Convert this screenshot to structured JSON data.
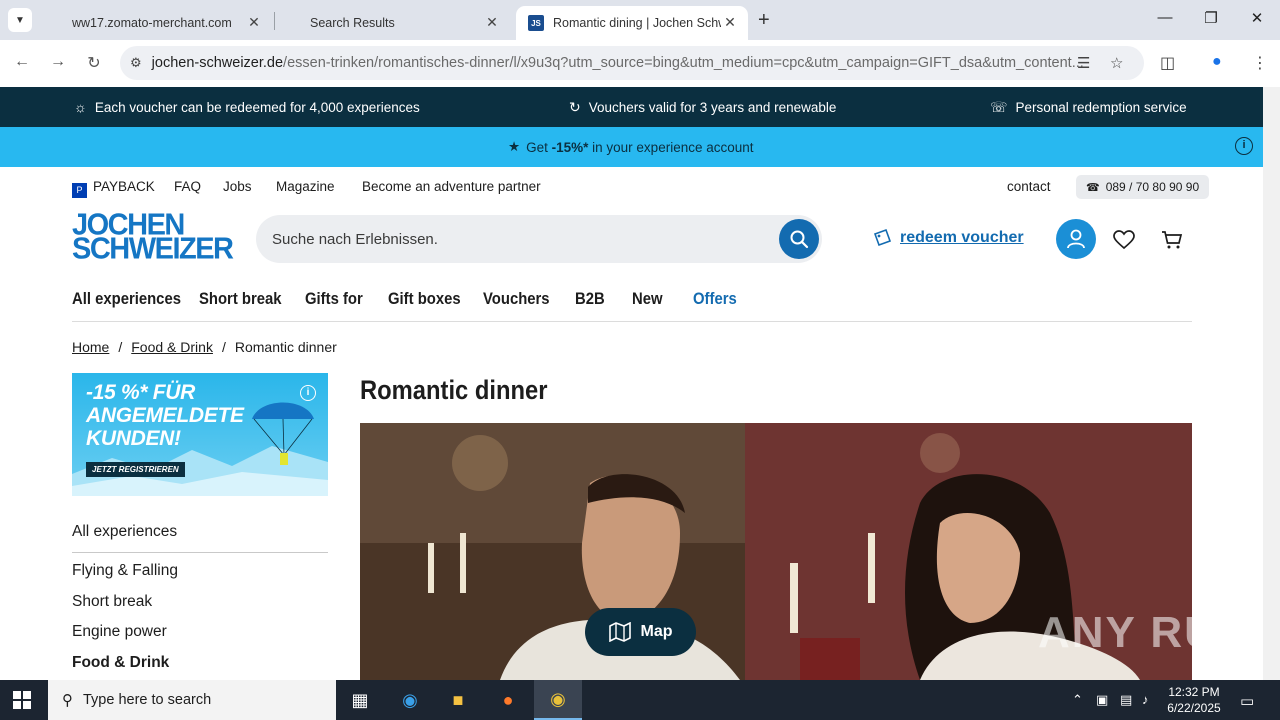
{
  "browser": {
    "tabs": [
      {
        "title": "ww17.zomato-merchant.com"
      },
      {
        "title": "Search Results"
      },
      {
        "title": "Romantic dining | Jochen Schweizer",
        "favicon": "JS"
      }
    ],
    "url_domain": "jochen-schweizer.de",
    "url_path": "/essen-trinken/romantisches-dinner/l/x9u3q?utm_source=bing&utm_medium=cpc&utm_campaign=GIFT_dsa&utm_content..."
  },
  "topbar": {
    "usp1": "Each voucher can be redeemed for 4,000 experiences",
    "usp2": "Vouchers valid for 3 years and renewable",
    "usp3": "Personal redemption service"
  },
  "promo": {
    "prefix": "Get ",
    "discount": "-15%*",
    "suffix": " in your experience account"
  },
  "meta_links": {
    "payback": "PAYBACK",
    "faq": "FAQ",
    "jobs": "Jobs",
    "magazine": "Magazine",
    "partner": "Become an adventure partner",
    "contact": "contact",
    "phone": "089 / 70 80 90 90"
  },
  "logo": {
    "line1": "JOCHEN",
    "line2": "SCHWEIZER"
  },
  "search": {
    "placeholder": "Suche nach Erlebnissen."
  },
  "redeem": {
    "label": "redeem voucher"
  },
  "nav": [
    "All experiences",
    "Short break",
    "Gifts for",
    "Gift boxes",
    "Vouchers",
    "B2B",
    "New",
    "Offers"
  ],
  "breadcrumb": {
    "home": "Home",
    "food": "Food & Drink",
    "current": "Romantic dinner"
  },
  "banner": {
    "line1": "-15 %* FÜR",
    "line2": "ANGEMELDETE",
    "line3": "KUNDEN!",
    "cta": "JETZT REGISTRIEREN"
  },
  "sidebar": {
    "all": "All experiences",
    "items": [
      "Flying & Falling",
      "Short break",
      "Engine power",
      "Food & Drink"
    ]
  },
  "page_title": "Romantic dinner",
  "map_button": "Map",
  "watermark": "ANY RUN",
  "taskbar": {
    "search_placeholder": "Type here to search",
    "time": "12:32 PM",
    "date": "6/22/2025"
  },
  "colors": {
    "brand_dark": "#0b2f40",
    "brand_blue": "#136bb0",
    "promo_cyan": "#28b8f0"
  }
}
